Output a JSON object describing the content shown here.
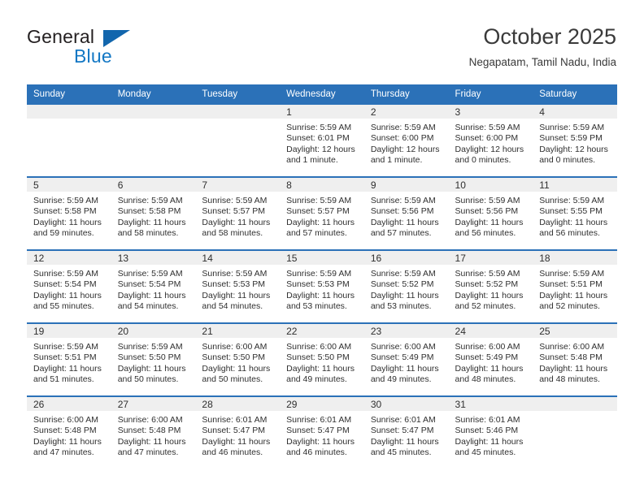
{
  "logo": {
    "word1": "General",
    "word2": "Blue",
    "triangle_icon": "blue-triangle-icon",
    "color_dark": "#231f20",
    "color_blue": "#1277c4"
  },
  "header": {
    "title": "October 2025",
    "location": "Negapatam, Tamil Nadu, India"
  },
  "colors": {
    "header_blue": "#2b71b8",
    "daynum_band": "#efefef",
    "text": "#2f2f2f"
  },
  "weekdays": [
    "Sunday",
    "Monday",
    "Tuesday",
    "Wednesday",
    "Thursday",
    "Friday",
    "Saturday"
  ],
  "weeks": [
    [
      {
        "day": "",
        "sunrise": "",
        "sunset": "",
        "daylight": "",
        "empty": true
      },
      {
        "day": "",
        "sunrise": "",
        "sunset": "",
        "daylight": "",
        "empty": true
      },
      {
        "day": "",
        "sunrise": "",
        "sunset": "",
        "daylight": "",
        "empty": true
      },
      {
        "day": "1",
        "sunrise": "Sunrise: 5:59 AM",
        "sunset": "Sunset: 6:01 PM",
        "daylight": "Daylight: 12 hours and 1 minute."
      },
      {
        "day": "2",
        "sunrise": "Sunrise: 5:59 AM",
        "sunset": "Sunset: 6:00 PM",
        "daylight": "Daylight: 12 hours and 1 minute."
      },
      {
        "day": "3",
        "sunrise": "Sunrise: 5:59 AM",
        "sunset": "Sunset: 6:00 PM",
        "daylight": "Daylight: 12 hours and 0 minutes."
      },
      {
        "day": "4",
        "sunrise": "Sunrise: 5:59 AM",
        "sunset": "Sunset: 5:59 PM",
        "daylight": "Daylight: 12 hours and 0 minutes."
      }
    ],
    [
      {
        "day": "5",
        "sunrise": "Sunrise: 5:59 AM",
        "sunset": "Sunset: 5:58 PM",
        "daylight": "Daylight: 11 hours and 59 minutes."
      },
      {
        "day": "6",
        "sunrise": "Sunrise: 5:59 AM",
        "sunset": "Sunset: 5:58 PM",
        "daylight": "Daylight: 11 hours and 58 minutes."
      },
      {
        "day": "7",
        "sunrise": "Sunrise: 5:59 AM",
        "sunset": "Sunset: 5:57 PM",
        "daylight": "Daylight: 11 hours and 58 minutes."
      },
      {
        "day": "8",
        "sunrise": "Sunrise: 5:59 AM",
        "sunset": "Sunset: 5:57 PM",
        "daylight": "Daylight: 11 hours and 57 minutes."
      },
      {
        "day": "9",
        "sunrise": "Sunrise: 5:59 AM",
        "sunset": "Sunset: 5:56 PM",
        "daylight": "Daylight: 11 hours and 57 minutes."
      },
      {
        "day": "10",
        "sunrise": "Sunrise: 5:59 AM",
        "sunset": "Sunset: 5:56 PM",
        "daylight": "Daylight: 11 hours and 56 minutes."
      },
      {
        "day": "11",
        "sunrise": "Sunrise: 5:59 AM",
        "sunset": "Sunset: 5:55 PM",
        "daylight": "Daylight: 11 hours and 56 minutes."
      }
    ],
    [
      {
        "day": "12",
        "sunrise": "Sunrise: 5:59 AM",
        "sunset": "Sunset: 5:54 PM",
        "daylight": "Daylight: 11 hours and 55 minutes."
      },
      {
        "day": "13",
        "sunrise": "Sunrise: 5:59 AM",
        "sunset": "Sunset: 5:54 PM",
        "daylight": "Daylight: 11 hours and 54 minutes."
      },
      {
        "day": "14",
        "sunrise": "Sunrise: 5:59 AM",
        "sunset": "Sunset: 5:53 PM",
        "daylight": "Daylight: 11 hours and 54 minutes."
      },
      {
        "day": "15",
        "sunrise": "Sunrise: 5:59 AM",
        "sunset": "Sunset: 5:53 PM",
        "daylight": "Daylight: 11 hours and 53 minutes."
      },
      {
        "day": "16",
        "sunrise": "Sunrise: 5:59 AM",
        "sunset": "Sunset: 5:52 PM",
        "daylight": "Daylight: 11 hours and 53 minutes."
      },
      {
        "day": "17",
        "sunrise": "Sunrise: 5:59 AM",
        "sunset": "Sunset: 5:52 PM",
        "daylight": "Daylight: 11 hours and 52 minutes."
      },
      {
        "day": "18",
        "sunrise": "Sunrise: 5:59 AM",
        "sunset": "Sunset: 5:51 PM",
        "daylight": "Daylight: 11 hours and 52 minutes."
      }
    ],
    [
      {
        "day": "19",
        "sunrise": "Sunrise: 5:59 AM",
        "sunset": "Sunset: 5:51 PM",
        "daylight": "Daylight: 11 hours and 51 minutes."
      },
      {
        "day": "20",
        "sunrise": "Sunrise: 5:59 AM",
        "sunset": "Sunset: 5:50 PM",
        "daylight": "Daylight: 11 hours and 50 minutes."
      },
      {
        "day": "21",
        "sunrise": "Sunrise: 6:00 AM",
        "sunset": "Sunset: 5:50 PM",
        "daylight": "Daylight: 11 hours and 50 minutes."
      },
      {
        "day": "22",
        "sunrise": "Sunrise: 6:00 AM",
        "sunset": "Sunset: 5:50 PM",
        "daylight": "Daylight: 11 hours and 49 minutes."
      },
      {
        "day": "23",
        "sunrise": "Sunrise: 6:00 AM",
        "sunset": "Sunset: 5:49 PM",
        "daylight": "Daylight: 11 hours and 49 minutes."
      },
      {
        "day": "24",
        "sunrise": "Sunrise: 6:00 AM",
        "sunset": "Sunset: 5:49 PM",
        "daylight": "Daylight: 11 hours and 48 minutes."
      },
      {
        "day": "25",
        "sunrise": "Sunrise: 6:00 AM",
        "sunset": "Sunset: 5:48 PM",
        "daylight": "Daylight: 11 hours and 48 minutes."
      }
    ],
    [
      {
        "day": "26",
        "sunrise": "Sunrise: 6:00 AM",
        "sunset": "Sunset: 5:48 PM",
        "daylight": "Daylight: 11 hours and 47 minutes."
      },
      {
        "day": "27",
        "sunrise": "Sunrise: 6:00 AM",
        "sunset": "Sunset: 5:48 PM",
        "daylight": "Daylight: 11 hours and 47 minutes."
      },
      {
        "day": "28",
        "sunrise": "Sunrise: 6:01 AM",
        "sunset": "Sunset: 5:47 PM",
        "daylight": "Daylight: 11 hours and 46 minutes."
      },
      {
        "day": "29",
        "sunrise": "Sunrise: 6:01 AM",
        "sunset": "Sunset: 5:47 PM",
        "daylight": "Daylight: 11 hours and 46 minutes."
      },
      {
        "day": "30",
        "sunrise": "Sunrise: 6:01 AM",
        "sunset": "Sunset: 5:47 PM",
        "daylight": "Daylight: 11 hours and 45 minutes."
      },
      {
        "day": "31",
        "sunrise": "Sunrise: 6:01 AM",
        "sunset": "Sunset: 5:46 PM",
        "daylight": "Daylight: 11 hours and 45 minutes."
      },
      {
        "day": "",
        "sunrise": "",
        "sunset": "",
        "daylight": "",
        "empty": true
      }
    ]
  ]
}
